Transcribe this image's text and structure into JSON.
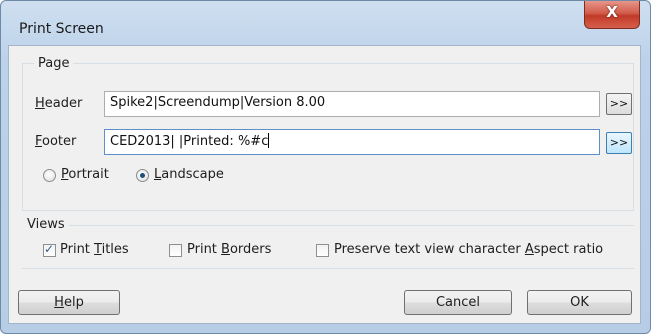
{
  "window": {
    "title": "Print Screen",
    "close_glyph": "X"
  },
  "page_group": {
    "title": "Page",
    "header": {
      "label_u": "H",
      "label_rest": "eader",
      "value": "Spike2|Screendump|Version 8.00",
      "button": ">>"
    },
    "footer": {
      "label_u": "F",
      "label_rest": "ooter",
      "value": "CED2013| |Printed: %#c",
      "button": ">>"
    },
    "orientation": {
      "portrait": {
        "label_u": "P",
        "label_rest": "ortrait",
        "selected": false
      },
      "landscape": {
        "label_u": "L",
        "label_rest": "andscape",
        "selected": true
      }
    }
  },
  "views_group": {
    "title": "Views",
    "print_titles": {
      "label_pre": "Print ",
      "label_u": "T",
      "label_rest": "itles",
      "checked": true
    },
    "print_borders": {
      "label_pre": "Print ",
      "label_u": "B",
      "label_rest": "orders",
      "checked": false
    },
    "preserve_aspect": {
      "label_pre": "Preserve text view character ",
      "label_u": "A",
      "label_rest": "spect ratio",
      "checked": false
    }
  },
  "buttons": {
    "help": {
      "label_u": "H",
      "label_rest": "elp"
    },
    "cancel": "Cancel",
    "ok": "OK"
  },
  "icons": {
    "check": "check-icon",
    "close": "close-icon"
  }
}
